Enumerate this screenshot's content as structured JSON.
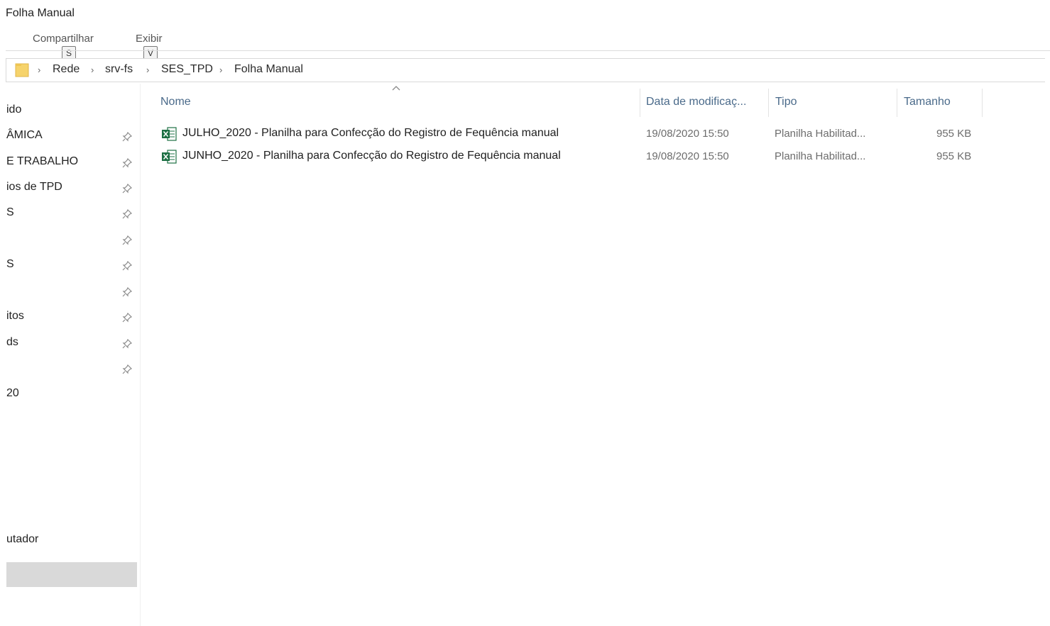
{
  "window": {
    "title": "Folha Manual"
  },
  "ribbon": {
    "tabs": [
      {
        "label": "Compartilhar",
        "keytip": "S"
      },
      {
        "label": "Exibir",
        "keytip": "V"
      }
    ]
  },
  "address": {
    "crumbs": [
      "Rede",
      "srv-fs",
      "SES_TPD",
      "Folha Manual"
    ]
  },
  "sidebar": {
    "items": [
      {
        "label": "ido",
        "pinned": false
      },
      {
        "label": "ÂMICA",
        "pinned": true
      },
      {
        "label": "E TRABALHO",
        "pinned": true
      },
      {
        "label": "ios de TPD",
        "pinned": true
      },
      {
        "label": "S",
        "pinned": true
      },
      {
        "label": "",
        "pinned": true
      },
      {
        "label": "S",
        "pinned": true
      },
      {
        "label": "",
        "pinned": true
      },
      {
        "label": "itos",
        "pinned": true
      },
      {
        "label": "ds",
        "pinned": true
      },
      {
        "label": "",
        "pinned": true
      },
      {
        "label": "20",
        "pinned": false
      },
      {
        "label": "utador",
        "pinned": false
      }
    ]
  },
  "columns": {
    "name": "Nome",
    "date": "Data de modificaç...",
    "type": "Tipo",
    "size": "Tamanho"
  },
  "files": [
    {
      "name": "JULHO_2020 - Planilha para Confecção do Registro de Fequência manual",
      "date": "19/08/2020 15:50",
      "type": "Planilha Habilitad...",
      "size": "955 KB",
      "icon": "excel-file-icon"
    },
    {
      "name": "JUNHO_2020 - Planilha para Confecção do Registro de Fequência manual",
      "date": "19/08/2020 15:50",
      "type": "Planilha Habilitad...",
      "size": "955 KB",
      "icon": "excel-file-icon"
    }
  ],
  "colors": {
    "excel_green": "#1d7044",
    "folder_yellow": "#f6d36b",
    "selection_gray": "#d9d9d9"
  }
}
